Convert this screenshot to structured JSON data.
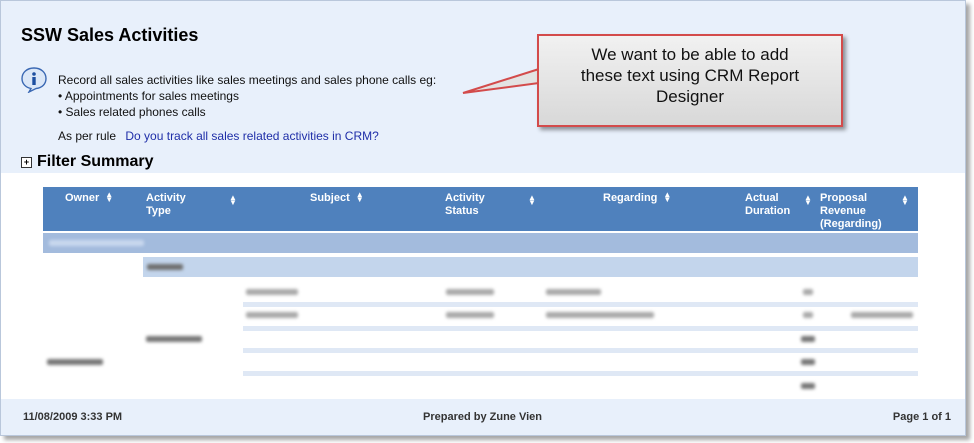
{
  "report": {
    "title": "SSW Sales Activities",
    "info_lines": [
      "Record all sales activities like sales meetings and sales phone calls eg:",
      "• Appointments for sales meetings",
      "• Sales related phones calls"
    ],
    "rule_prefix": "As per rule",
    "rule_link": "Do you track all sales related activities in CRM?",
    "filter_label": "Filter Summary",
    "filter_toggle": "+"
  },
  "callout": {
    "text_lines": [
      "We want to be able to add",
      "these text using CRM Report",
      "Designer"
    ],
    "border_color": "#d34b4b"
  },
  "table": {
    "header_color": "#4f81bd",
    "columns": [
      {
        "label": [
          "Owner"
        ]
      },
      {
        "label": [
          "Activity",
          "Type"
        ]
      },
      {
        "label": [
          "Subject"
        ]
      },
      {
        "label": [
          "Activity",
          "Status"
        ]
      },
      {
        "label": [
          "Regarding"
        ]
      },
      {
        "label": [
          "Actual",
          "Duration"
        ]
      },
      {
        "label": [
          "Proposal",
          "Revenue",
          "(Regarding)"
        ]
      }
    ]
  },
  "footer": {
    "date": "11/08/2009 3:33 PM",
    "prepared_by": "Prepared by Zune Vien",
    "page": "Page 1 of 1"
  }
}
